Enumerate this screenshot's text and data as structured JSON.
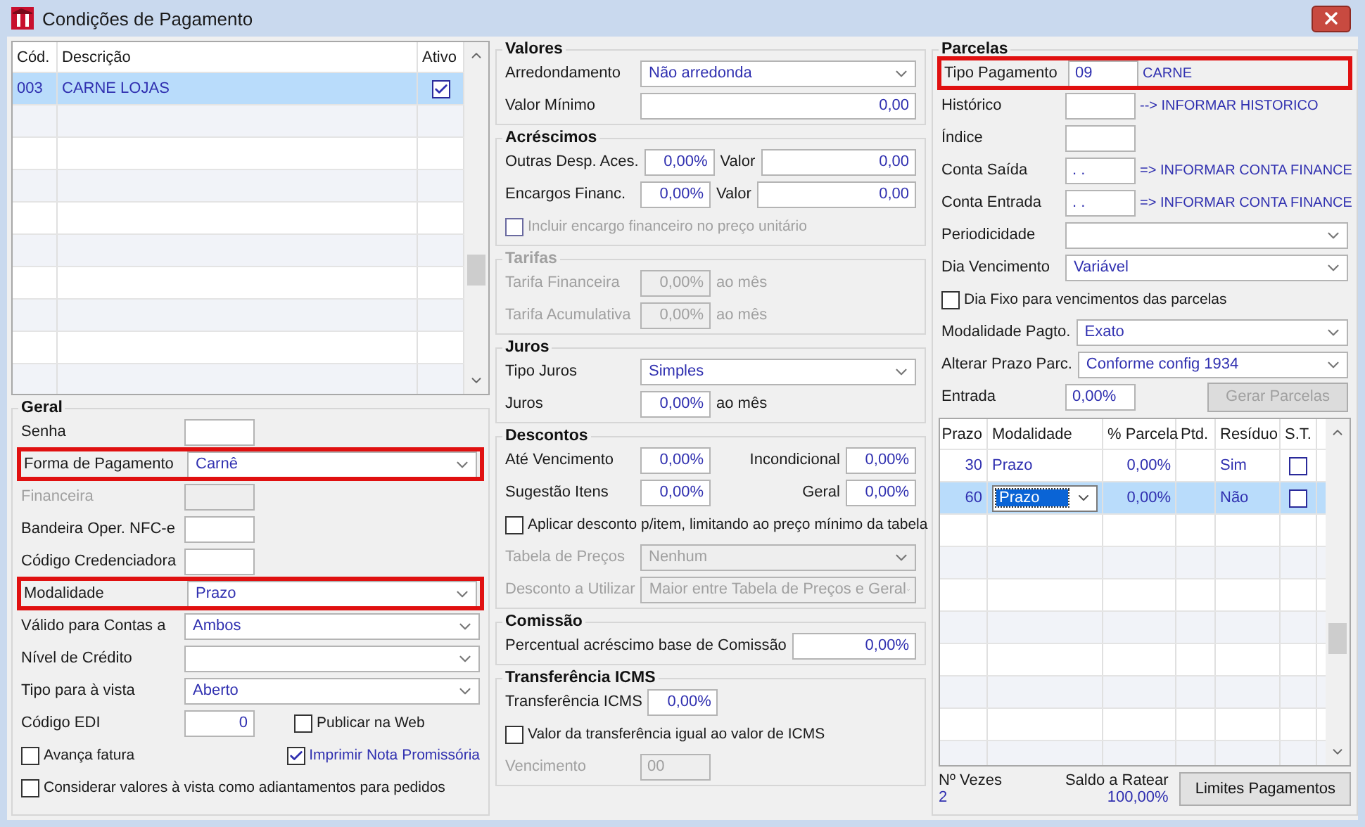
{
  "window": {
    "title": "Condições de Pagamento"
  },
  "payment_list": {
    "columns": [
      "Cód.",
      "Descrição",
      "Ativo"
    ],
    "rows": [
      {
        "code": "003",
        "description": "CARNE LOJAS",
        "active": true,
        "selected": true
      }
    ]
  },
  "geral": {
    "title": "Geral",
    "rows": [
      {
        "kind": "input",
        "label": "Senha"
      },
      {
        "kind": "select",
        "label": "Forma de Pagamento",
        "value": "Carnê",
        "highlighted": true
      },
      {
        "kind": "input",
        "label": "Financeira",
        "disabled": true
      },
      {
        "kind": "input",
        "label": "Bandeira Oper. NFC-e"
      },
      {
        "kind": "input",
        "label": "Código Credenciadora"
      },
      {
        "kind": "select",
        "label": "Modalidade",
        "value": "Prazo",
        "highlighted": true
      },
      {
        "kind": "select",
        "label": "Válido para Contas a",
        "value": "Ambos"
      },
      {
        "kind": "select",
        "label": "Nível de Crédito"
      },
      {
        "kind": "select",
        "label": "Tipo para à vista",
        "value": "Aberto"
      },
      {
        "kind": "input",
        "label": "Código EDI",
        "value": "0",
        "check": {
          "label": "Publicar na Web",
          "checked": false
        }
      },
      {
        "kind": "checks",
        "items": [
          {
            "label": "Avança fatura",
            "checked": false
          },
          {
            "label": "Imprimir Nota Promissória",
            "checked": true
          }
        ]
      },
      {
        "kind": "check",
        "label": "Considerar valores à vista como adiantamentos para pedidos",
        "checked": false
      }
    ]
  },
  "groups": [
    {
      "title": "Valores",
      "disabled": false,
      "rows": [
        {
          "kind": "select",
          "label": "Arredondamento",
          "value": "Não arredonda"
        },
        {
          "kind": "wide",
          "label": "Valor Mínimo",
          "value": "0,00"
        }
      ]
    },
    {
      "title": "Acréscimos",
      "disabled": false,
      "rows": [
        {
          "kind": "input",
          "label": "Outras Desp. Aces.",
          "value": "0,00%",
          "second": {
            "kind": "wide",
            "label": "Valor",
            "value": "0,00"
          }
        },
        {
          "kind": "input",
          "label": "Encargos Financ.",
          "value": "0,00%",
          "second": {
            "kind": "wide",
            "label": "Valor",
            "value": "0,00"
          }
        },
        {
          "kind": "check",
          "label": "Incluir encargo financeiro no preço unitário",
          "checked": false,
          "disabled": true
        }
      ]
    },
    {
      "title": "Tarifas",
      "disabled": true,
      "rows": [
        {
          "kind": "input",
          "label": "Tarifa Financeira",
          "value": "0,00%",
          "suffix": "ao mês"
        },
        {
          "kind": "input",
          "label": "Tarifa Acumulativa",
          "value": "0,00%",
          "suffix": "ao mês"
        }
      ]
    },
    {
      "title": "Juros",
      "disabled": false,
      "rows": [
        {
          "kind": "select",
          "label": "Tipo Juros",
          "value": "Simples"
        },
        {
          "kind": "input",
          "label": "Juros",
          "value": "0,00%",
          "suffix": "ao mês"
        }
      ]
    },
    {
      "title": "Descontos",
      "disabled": false,
      "rows": [
        {
          "kind": "input",
          "label": "Até Vencimento",
          "value": "0,00%",
          "second": {
            "kind": "input",
            "label": "Incondicional",
            "value": "0,00%"
          }
        },
        {
          "kind": "input",
          "label": "Sugestão Itens",
          "value": "0,00%",
          "second": {
            "kind": "input",
            "label": "Geral",
            "value": "0,00%"
          }
        },
        {
          "kind": "check",
          "label": "Aplicar desconto p/item, limitando ao preço mínimo da tabela",
          "checked": false
        },
        {
          "kind": "select",
          "label": "Tabela de Preços",
          "value": "Nenhum",
          "disabled": true
        },
        {
          "kind": "select",
          "label": "Desconto a Utilizar",
          "value": "Maior entre Tabela de Preços e Geral",
          "disabled": true
        }
      ]
    },
    {
      "title": "Comissão",
      "disabled": false,
      "rows": [
        {
          "kind": "wide",
          "label": "Percentual acréscimo base de Comissão",
          "value": "0,00%"
        }
      ]
    },
    {
      "title": "Transferência ICMS",
      "disabled": false,
      "rows": [
        {
          "kind": "input",
          "label": "Transferência ICMS",
          "value": "0,00%"
        },
        {
          "kind": "check",
          "label": "Valor da transferência igual ao valor de ICMS",
          "checked": false
        },
        {
          "kind": "code",
          "label": "Vencimento",
          "value": "00",
          "disabled": true
        }
      ]
    }
  ],
  "parcelas": {
    "title": "Parcelas",
    "rows": [
      {
        "kind": "code",
        "label": "Tipo Pagamento",
        "value": "09",
        "note": "CARNE",
        "highlighted": true
      },
      {
        "kind": "code",
        "label": "Histórico",
        "note": "--> INFORMAR HISTORICO"
      },
      {
        "kind": "code",
        "label": "Índice"
      },
      {
        "kind": "code",
        "label": "Conta Saída",
        "value": ". .",
        "note": "=> INFORMAR CONTA FINANCE"
      },
      {
        "kind": "code",
        "label": "Conta Entrada",
        "value": ". .",
        "note": "=> INFORMAR CONTA FINANCE"
      },
      {
        "kind": "select",
        "label": "Periodicidade"
      },
      {
        "kind": "select",
        "label": "Dia Vencimento",
        "value": "Variável"
      },
      {
        "kind": "check",
        "label": "Dia Fixo para vencimentos das parcelas",
        "checked": false
      },
      {
        "kind": "select",
        "label": "Modalidade Pagto.",
        "value": "Exato"
      },
      {
        "kind": "select",
        "label": "Alterar Prazo Parc.",
        "value": "Conforme config 1934"
      },
      {
        "kind": "code",
        "label": "Entrada",
        "value": "0,00%",
        "button": {
          "label": "Gerar Parcelas",
          "disabled": true
        }
      }
    ],
    "table": {
      "columns": [
        "Prazo",
        "Modalidade",
        "% Parcela",
        "Ptd.",
        "Resíduo",
        "S.T."
      ],
      "rows": [
        {
          "prazo": "30",
          "modalidade": "Prazo",
          "editing": false,
          "parcela": "0,00%",
          "residuo": "Sim",
          "st": false,
          "selected": false
        },
        {
          "prazo": "60",
          "modalidade": "Prazo",
          "editing": true,
          "parcela": "0,00%",
          "residuo": "Não",
          "st": false,
          "selected": true
        }
      ]
    },
    "footer": {
      "count_label": "Nº Vezes",
      "count": "2",
      "balance_label": "Saldo a Ratear",
      "balance": "100,00%",
      "button": "Limites Pagamentos"
    }
  }
}
